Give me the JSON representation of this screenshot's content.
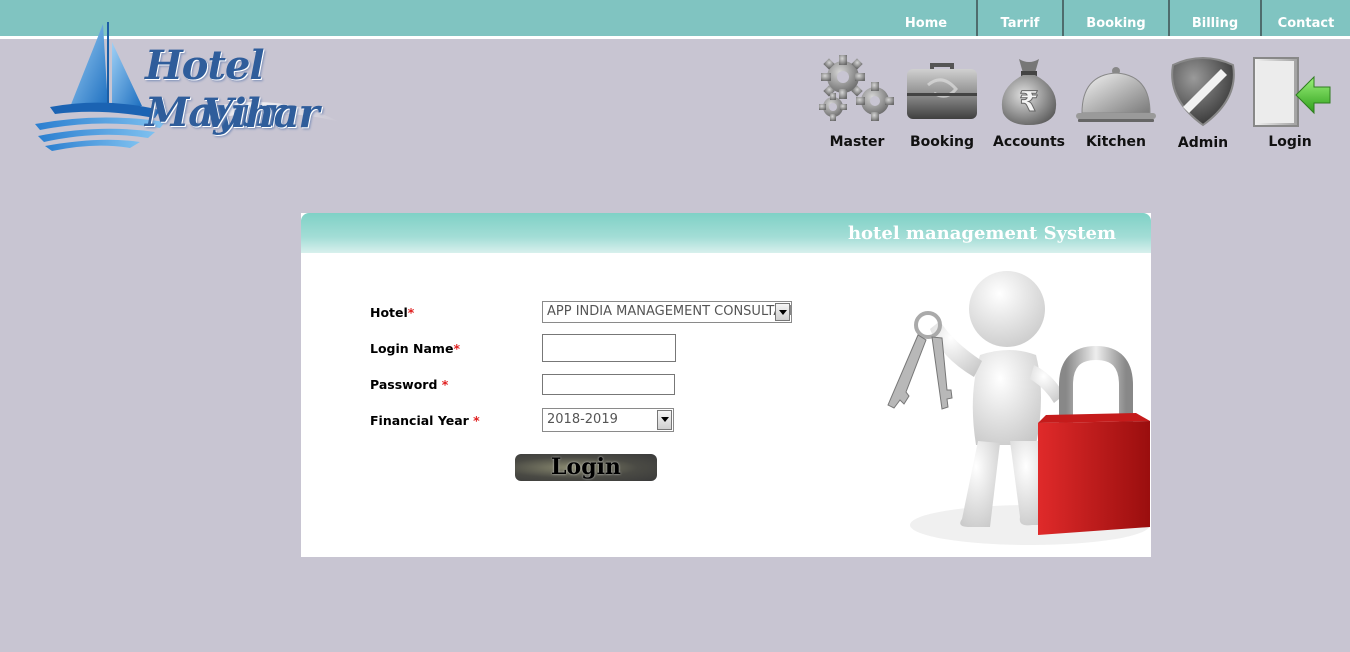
{
  "top_nav": {
    "items": [
      {
        "label": "Home"
      },
      {
        "label": "Tarrif"
      },
      {
        "label": "Booking"
      },
      {
        "label": "Billing"
      },
      {
        "label": "Contact"
      }
    ]
  },
  "logo": {
    "line1": "Hotel Mayur",
    "line2": "Vihar"
  },
  "icon_menu": {
    "items": [
      {
        "label": "Master",
        "icon": "gears-icon"
      },
      {
        "label": "Booking",
        "icon": "briefcase-icon"
      },
      {
        "label": "Accounts",
        "icon": "money-bag-icon"
      },
      {
        "label": "Kitchen",
        "icon": "cloche-icon"
      },
      {
        "label": "Admin",
        "icon": "badge-icon"
      },
      {
        "label": "Login",
        "icon": "login-door-icon"
      }
    ]
  },
  "login_panel": {
    "title": "hotel management System",
    "fields": {
      "hotel": {
        "label": "Hotel",
        "required": "*",
        "value": "APP INDIA MANAGEMENT CONSULTANTS"
      },
      "login_name": {
        "label": "Login Name",
        "required": "*",
        "value": ""
      },
      "password": {
        "label": "Password",
        "required": "*",
        "value": ""
      },
      "financial_year": {
        "label": "Financial Year",
        "required": "*",
        "value": "2018-2019"
      }
    },
    "login_button": "Login"
  },
  "colors": {
    "background": "#c8c5d2",
    "topbar": "#80c4c1",
    "panel_header": "#7fd1c6",
    "required": "#e02020",
    "logo_text": "#2f5d9b"
  }
}
